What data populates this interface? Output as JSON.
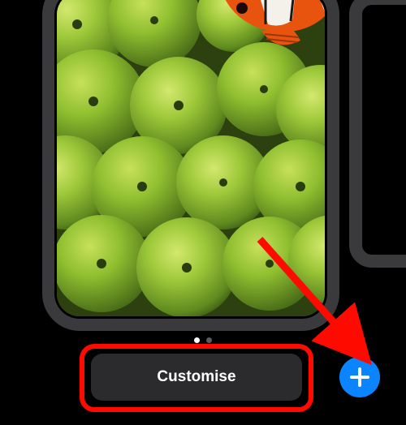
{
  "buttons": {
    "customise_label": "Customise"
  },
  "pager": {
    "count": 2,
    "active": 0
  },
  "icons": {
    "add": "plus"
  },
  "annotation": {
    "highlight_color": "#ff0a00",
    "arrow_color": "#ff0a00",
    "accent_color": "#0a84ff"
  }
}
